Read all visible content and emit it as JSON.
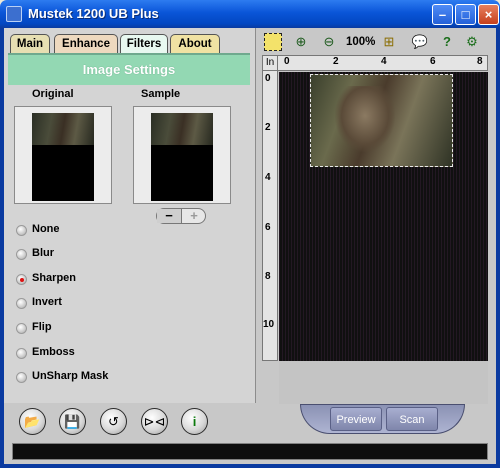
{
  "window": {
    "title": "Mustek 1200 UB Plus"
  },
  "tabs": [
    {
      "label": "Main"
    },
    {
      "label": "Enhance"
    },
    {
      "label": "Filters",
      "active": true
    },
    {
      "label": "About"
    }
  ],
  "image_settings": {
    "title": "Image Settings",
    "original_label": "Original",
    "sample_label": "Sample",
    "minus": "−",
    "plus": "+"
  },
  "filters": {
    "selected": "Sharpen",
    "options": [
      "None",
      "Blur",
      "Sharpen",
      "Invert",
      "Flip",
      "Emboss",
      "UnSharp Mask"
    ]
  },
  "toolbar": {
    "zoom": "100%"
  },
  "ruler": {
    "unit": "In",
    "h_labels": [
      "0",
      "2",
      "4",
      "6",
      "8"
    ],
    "v_labels": [
      "0",
      "2",
      "4",
      "6",
      "8",
      "10"
    ]
  },
  "actions": {
    "preview": "Preview",
    "scan": "Scan"
  },
  "icons": {
    "toolbar": [
      "select-area-icon",
      "zoom-in-icon",
      "zoom-out-icon",
      "fit-area-icon",
      "comment-icon",
      "help-icon",
      "settings-icon"
    ],
    "bottom": [
      "open-icon",
      "save-icon",
      "reset-icon",
      "frame-icon",
      "info-icon"
    ]
  },
  "colors": {
    "titlebar": "#0a55d8",
    "settings_bar": "#93d8b3",
    "preview_buttons": "#8b92b4",
    "active_tab": "#e8f8f0"
  }
}
